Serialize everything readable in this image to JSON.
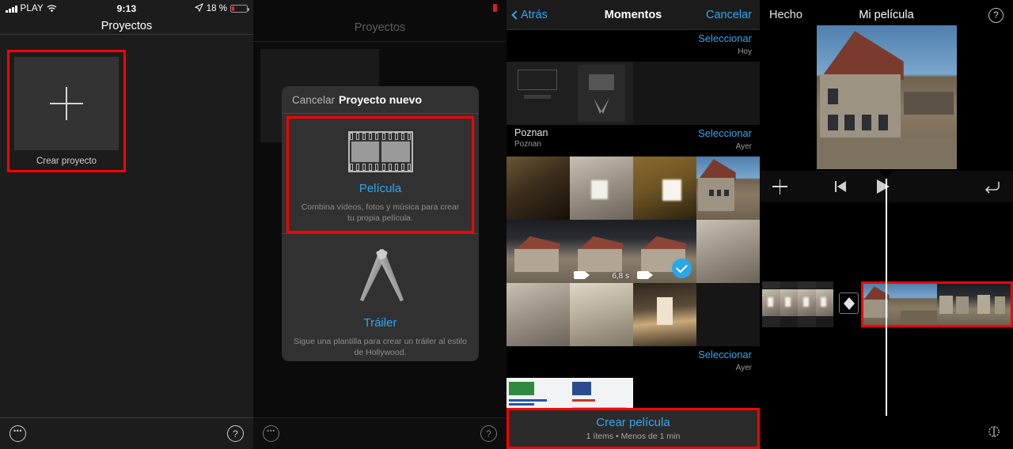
{
  "panel1": {
    "status_bar": {
      "carrier": "PLAY",
      "time": "9:13",
      "battery_percent": "18 %",
      "signal_icon": "signal-bars-icon",
      "wifi_icon": "wifi-icon",
      "location_icon": "location-arrow-icon",
      "battery_icon": "battery-icon"
    },
    "nav_title": "Proyectos",
    "create_project": {
      "label": "Crear proyecto",
      "icon": "plus-icon",
      "highlight_color": "#ff0000"
    },
    "bottom_bar": {
      "more_icon": "ellipsis-circle-icon",
      "help_icon": "question-circle-icon"
    }
  },
  "panel2": {
    "background_title": "Proyectos",
    "modal": {
      "cancel_label": "Cancelar",
      "title": "Proyecto nuevo",
      "options": [
        {
          "name": "Película",
          "description": "Combina vídeos, fotos y música para crear tu propia película.",
          "icon": "film-strip-icon",
          "highlighted": true,
          "accent": "#2fa8f0"
        },
        {
          "name": "Tráiler",
          "description": "Sigue una plantilla para crear un tráiler al estilo de Hollywood.",
          "icon": "clapper-spotlights-icon",
          "highlighted": false,
          "accent": "#2fa8f0"
        }
      ]
    },
    "bottom_bar": {
      "more_icon": "ellipsis-circle-icon",
      "help_icon": "question-circle-icon"
    }
  },
  "panel3": {
    "nav": {
      "back_label": "Atrás",
      "back_icon": "chevron-left-icon",
      "title": "Momentos",
      "cancel_label": "Cancelar"
    },
    "sections": [
      {
        "name": "",
        "subtitle": "",
        "select_label": "Seleccionar",
        "date": "Hoy",
        "items": [
          {
            "art": "art-shot",
            "type": "image",
            "selected": false
          },
          {
            "art": "art-shot",
            "type": "image",
            "selected": false
          },
          {
            "art": "art-dark",
            "type": "image",
            "selected": false
          },
          {
            "art": "art-dark",
            "type": "image",
            "selected": false
          }
        ]
      },
      {
        "name": "Poznan",
        "subtitle": "Poznan",
        "select_label": "Seleccionar",
        "date": "Ayer",
        "items": [
          {
            "art": "art-int1",
            "type": "image",
            "selected": false
          },
          {
            "art": "art-int2",
            "type": "image",
            "selected": false
          },
          {
            "art": "art-int3",
            "type": "image",
            "selected": false
          },
          {
            "art": "art-house",
            "type": "image",
            "selected": false
          },
          {
            "art": "art-ext2",
            "type": "image",
            "selected": false
          },
          {
            "art": "art-ext2",
            "type": "video",
            "duration": "6,8 s",
            "selected": false
          },
          {
            "art": "art-ext2",
            "type": "video",
            "duration": "",
            "selected": true
          },
          {
            "art": "art-int2",
            "type": "image",
            "selected": false
          },
          {
            "art": "art-int2",
            "type": "image",
            "selected": false
          },
          {
            "art": "art-stair",
            "type": "image",
            "selected": false
          },
          {
            "art": "art-hall",
            "type": "image",
            "selected": false
          },
          {
            "art": "art-dark",
            "type": "image",
            "selected": false
          }
        ]
      },
      {
        "name": "",
        "subtitle": "",
        "select_label": "Seleccionar",
        "date": "Ayer",
        "items": [
          {
            "art": "art-web",
            "type": "image",
            "selected": false
          },
          {
            "art": "art-web",
            "type": "image",
            "selected": false
          }
        ]
      }
    ],
    "create_bar": {
      "cta": "Crear película",
      "meta": "1 ítems • Menos de 1 min",
      "accent": "#2fa8f0",
      "highlight_color": "#ff0000"
    },
    "video_badge_icon": "video-camera-icon",
    "selected_icon": "checkmark-circle-icon"
  },
  "panel4": {
    "nav": {
      "done_label": "Hecho",
      "title": "Mi película",
      "help_icon": "question-circle-icon"
    },
    "preview": {
      "description": "Edificio con tejado de tejas y cielo azul"
    },
    "toolbar": {
      "add_icon": "plus-icon",
      "skip-to-start_icon": "skip-to-start-icon",
      "play_icon": "play-icon",
      "undo_icon": "undo-arrow-icon"
    },
    "timeline": {
      "playhead_icon": "playhead-marker-icon",
      "transition_icon": "transition-icon",
      "selected_clip_highlight": "#ff0000"
    },
    "bottom_bar": {
      "settings_icon": "gear-icon"
    }
  }
}
